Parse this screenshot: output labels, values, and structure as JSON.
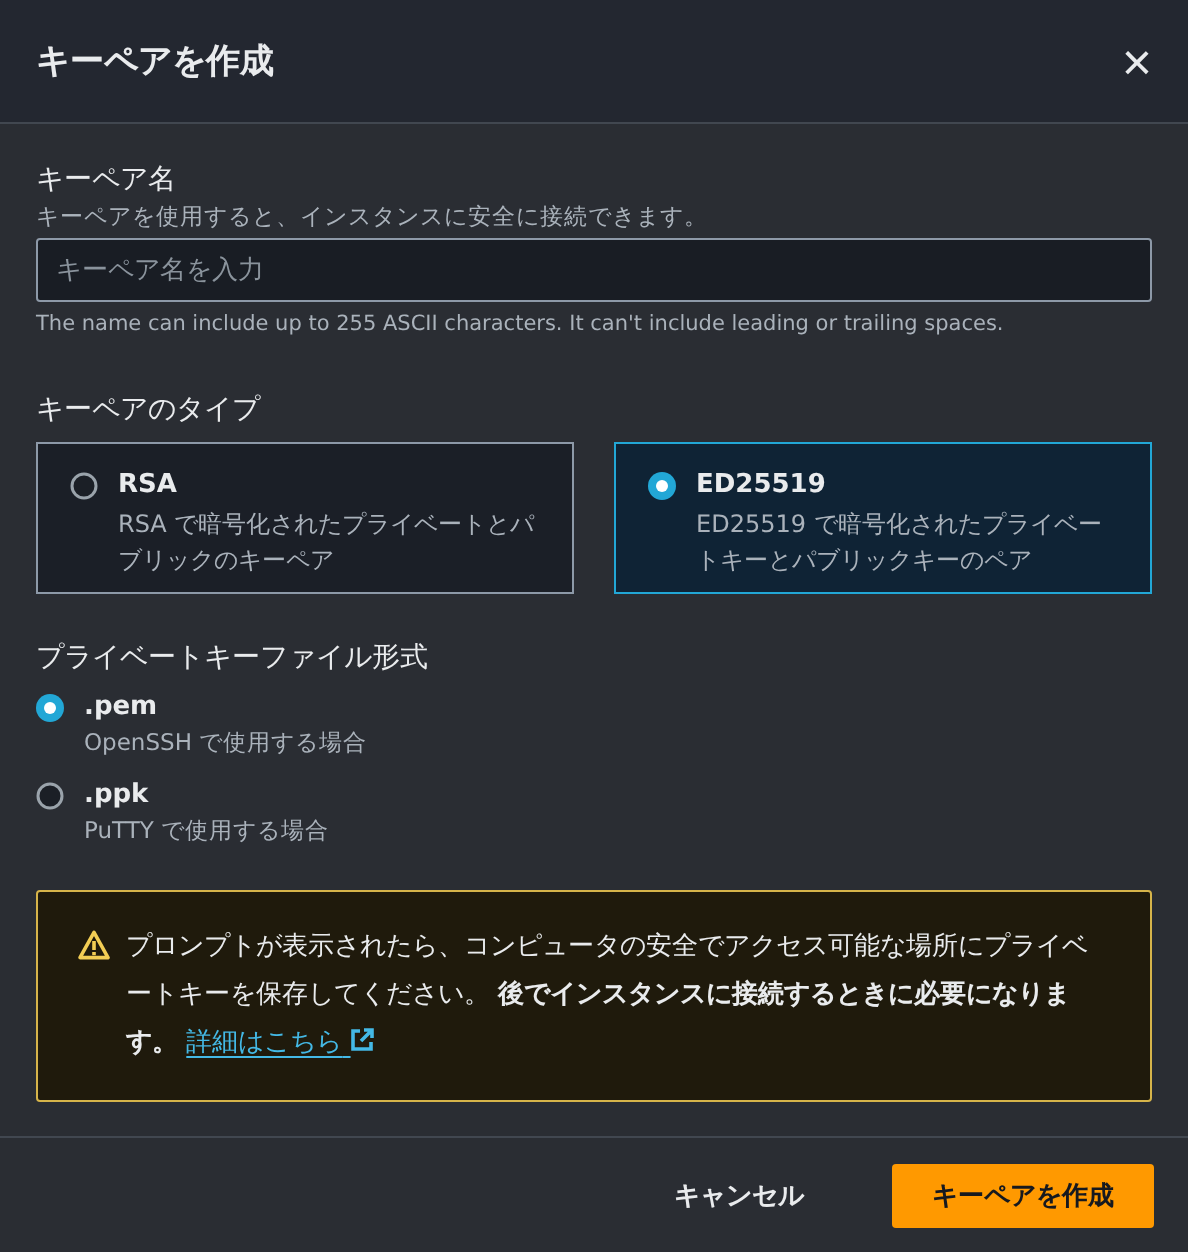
{
  "dialog": {
    "title": "キーペアを作成",
    "close_icon": "×"
  },
  "key_name": {
    "label": "キーペア名",
    "description": "キーペアを使用すると、インスタンスに安全に接続できます。",
    "placeholder": "キーペア名を入力",
    "hint": "The name can include up to 255 ASCII characters. It can't include leading or trailing spaces."
  },
  "key_type": {
    "label": "キーペアのタイプ",
    "options": [
      {
        "label": "RSA",
        "description": "RSA で暗号化されたプライベートとパブリックのキーペア",
        "selected": false
      },
      {
        "label": "ED25519",
        "description": "ED25519 で暗号化されたプライベートキーとパブリックキーのペア",
        "selected": true
      }
    ]
  },
  "file_format": {
    "label": "プライベートキーファイル形式",
    "options": [
      {
        "label": ".pem",
        "description": "OpenSSH で使用する場合",
        "selected": true
      },
      {
        "label": ".ppk",
        "description": "PuTTY で使用する場合",
        "selected": false
      }
    ]
  },
  "alert": {
    "text": "プロンプトが表示されたら、コンピュータの安全でアクセス可能な場所にプライベートキーを保存してください。 **後でインスタンスに接続するときに必要になります。**",
    "link": "詳細はこちら"
  },
  "buttons": [
    {
      "label": "キャンセル",
      "kind": "secondary"
    },
    {
      "label": "キーペアを作成",
      "kind": "primary"
    }
  ]
}
